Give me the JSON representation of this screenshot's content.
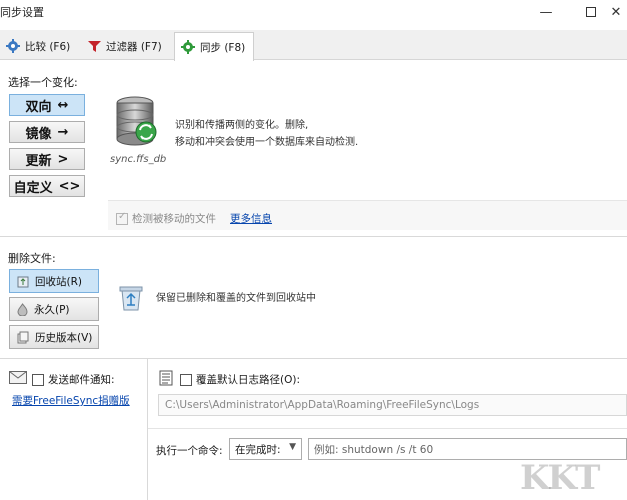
{
  "window": {
    "title": "同步设置",
    "minimize_glyph": "—",
    "close_glyph": "✕"
  },
  "tabs": [
    {
      "label": "比较 (F6)",
      "icon": "gear-blue-icon",
      "selected": false
    },
    {
      "label": "过滤器 (F7)",
      "icon": "funnel-red-icon",
      "selected": false
    },
    {
      "label": "同步 (F8)",
      "icon": "gear-green-icon",
      "selected": true
    }
  ],
  "variant": {
    "heading": "选择一个变化:",
    "buttons": [
      {
        "label": "双向",
        "glyph": "↔",
        "selected": true
      },
      {
        "label": "镜像",
        "glyph": "→",
        "selected": false
      },
      {
        "label": "更新",
        "glyph": ">",
        "selected": false
      },
      {
        "label": "自定义",
        "glyph": "<>",
        "selected": false
      }
    ],
    "description_line1": "识别和传播两侧的变化。删除,",
    "description_line2": "移动和冲突会使用一个数据库来自动检测.",
    "db_filename": "sync.ffs_db",
    "detect_moved_label": "检测被移动的文件",
    "detect_moved_checked": true,
    "more_info_link": "更多信息"
  },
  "deletion": {
    "heading": "删除文件:",
    "buttons": [
      {
        "label": "回收站(R)",
        "icon": "recycle-bin-icon",
        "selected": true
      },
      {
        "label": "永久(P)",
        "icon": "flame-icon",
        "selected": false
      },
      {
        "label": "历史版本(V)",
        "icon": "versioning-icon",
        "selected": false
      }
    ],
    "description": "保留已删除和覆盖的文件到回收站中"
  },
  "email": {
    "checkbox_label": "发送邮件通知:",
    "checked": false,
    "donate_link": "需要FreeFileSync捐赠版"
  },
  "log": {
    "checkbox_label": "覆盖默认日志路径(O):",
    "checked": false,
    "path": "C:\\Users\\Administrator\\AppData\\Roaming\\FreeFileSync\\Logs"
  },
  "command": {
    "label": "执行一个命令:",
    "trigger_value": "在完成时:",
    "command_placeholder": "例如: shutdown /s /t 60"
  },
  "watermark": "KKT"
}
